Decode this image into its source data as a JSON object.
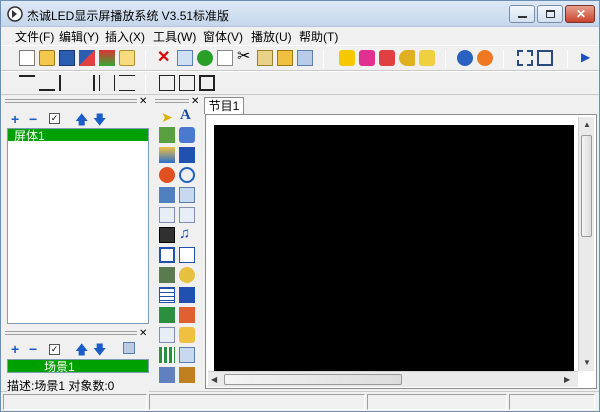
{
  "window": {
    "title": "杰诚LED显示屏播放系统 V3.51标准版"
  },
  "menu": [
    "文件(F)",
    "编辑(Y)",
    "插入(X)",
    "工具(W)",
    "窗体(V)",
    "播放(U)",
    "帮助(T)"
  ],
  "left_panel": {
    "screens": [
      "屏体1"
    ],
    "scenes": [
      "场景1"
    ],
    "description": "描述:场景1 对象数:0"
  },
  "document": {
    "tab": "节目1"
  },
  "colors": {
    "accent_green": "#00a000",
    "canvas": "#000000"
  }
}
